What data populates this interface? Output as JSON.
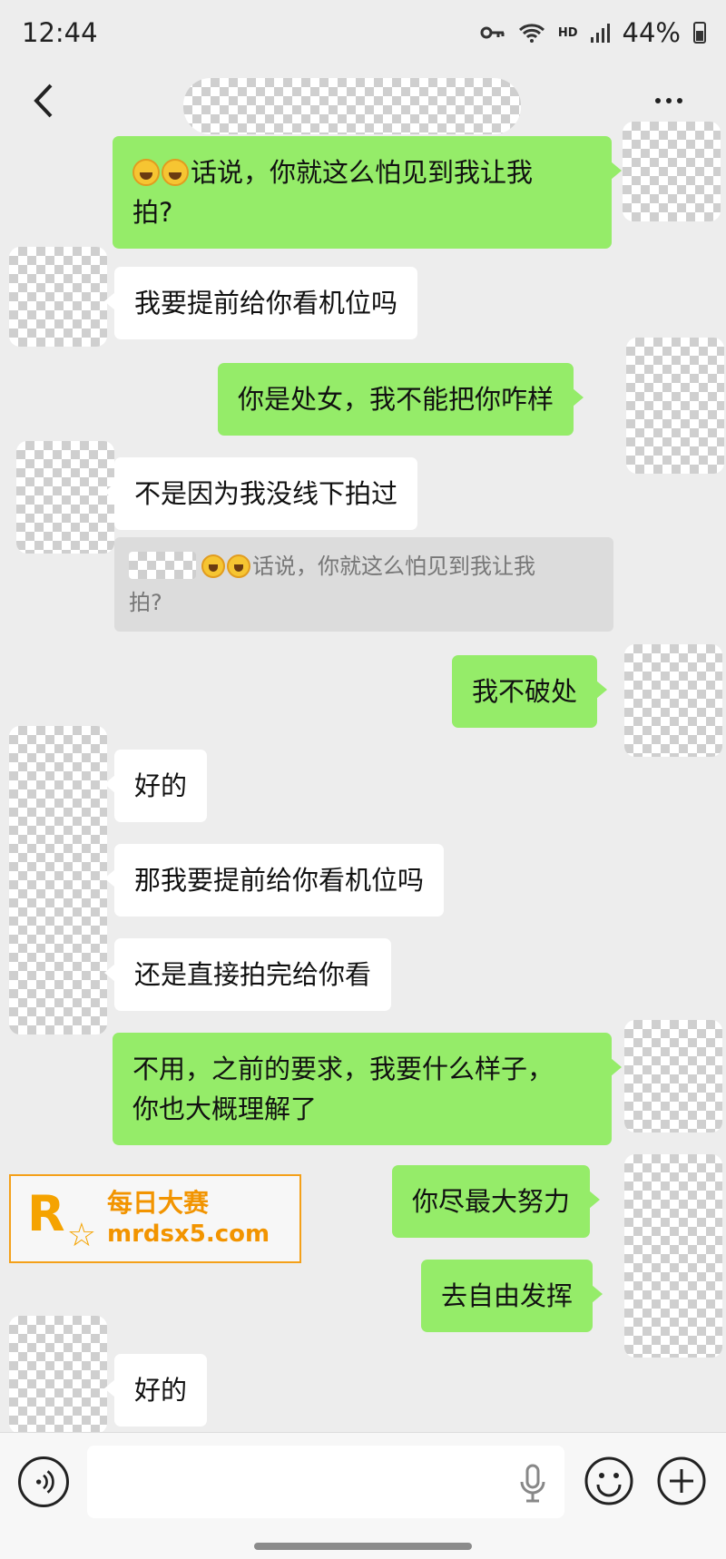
{
  "status_bar": {
    "time": "12:44",
    "network": "HD",
    "battery": "44%"
  },
  "header": {
    "back_icon": "chevron-left-icon",
    "more_icon": "more-dots-icon"
  },
  "messages": [
    {
      "side": "me",
      "emojis": 2,
      "text": "话说，你就这么怕见到我让我\n拍?"
    },
    {
      "side": "them",
      "text": "我要提前给你看机位吗"
    },
    {
      "side": "me",
      "text": "你是处女，我不能把你咋样"
    },
    {
      "side": "them",
      "text": "不是因为我没线下拍过"
    },
    {
      "side": "me",
      "text": "我不破处"
    },
    {
      "side": "them",
      "text": "好的"
    },
    {
      "side": "them",
      "text": "那我要提前给你看机位吗"
    },
    {
      "side": "them",
      "text": "还是直接拍完给你看"
    },
    {
      "side": "me",
      "text": "不用，之前的要求，我要什么样子，\n你也大概理解了"
    },
    {
      "side": "me",
      "text": "你尽最大努力"
    },
    {
      "side": "me",
      "text": "去自由发挥"
    },
    {
      "side": "them",
      "text": "好的"
    }
  ],
  "quote": {
    "line1": "话说，你就这么怕见到我让我",
    "line2": "拍?"
  },
  "watermark": {
    "logo_letter": "R",
    "name": "每日大赛",
    "url": "mrdsx5.com"
  },
  "input_bar": {
    "placeholder": "",
    "icons": [
      "voice-icon",
      "mic-icon",
      "emoji-icon",
      "plus-icon"
    ]
  },
  "colors": {
    "me_bubble": "#95ec69",
    "them_bubble": "#ffffff",
    "background": "#ededed",
    "watermark": "#f29400"
  }
}
